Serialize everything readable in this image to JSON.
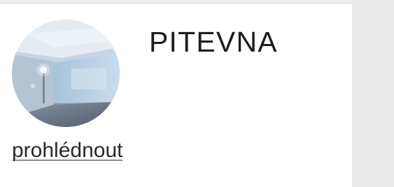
{
  "item": {
    "title": "PITEVNA",
    "link_label": "prohlédnout",
    "thumbnail_icon": "room-photo-thumbnail"
  },
  "colors": {
    "page_background": "#ebebeb",
    "card_background": "#ffffff",
    "title_text": "#1d1d1d",
    "link_text": "#2a2a2a"
  }
}
